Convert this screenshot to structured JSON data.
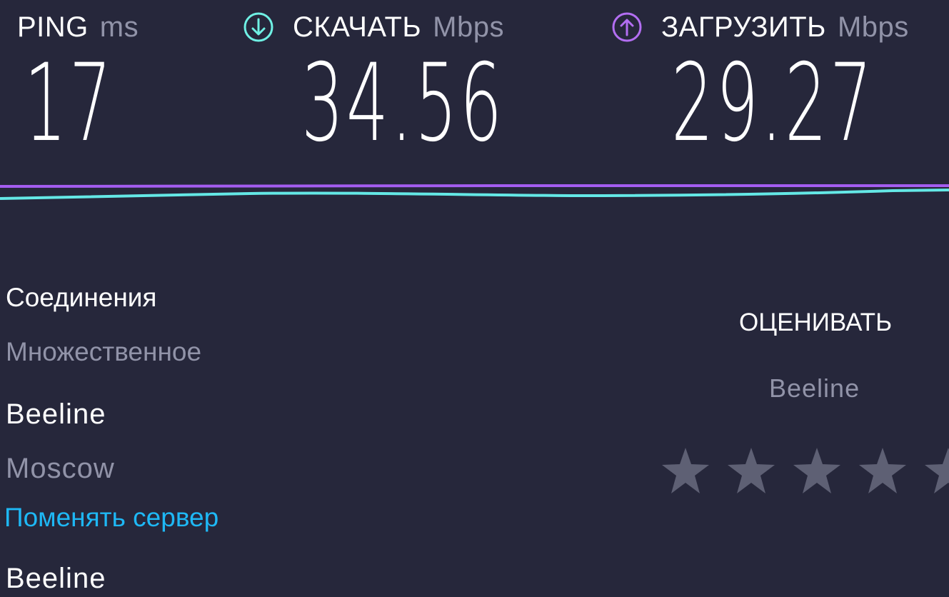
{
  "metrics": {
    "ping": {
      "name": "PING",
      "unit": "ms",
      "value": "17"
    },
    "download": {
      "name": "СКАЧАТЬ",
      "unit": "Mbps",
      "value": "34.56",
      "icon": "download-arrow-icon",
      "color": "#6ff0e4"
    },
    "upload": {
      "name": "ЗАГРУЗИТЬ",
      "unit": "Mbps",
      "value": "29.27",
      "icon": "upload-arrow-icon",
      "color": "#b36ef2"
    }
  },
  "graph": {
    "upload_color": "#a45df0",
    "download_color": "#64e8e6"
  },
  "connection": {
    "title": "Соединения",
    "type": "Множественное",
    "provider": "Beeline",
    "city": "Moscow",
    "change_server": "Поменять сервер",
    "server": "Beeline"
  },
  "rating": {
    "title": "ОЦЕНИВАТЬ",
    "provider": "Beeline",
    "stars_icon": "star-icon",
    "star_color": "#5e6074"
  },
  "colors": {
    "background": "#26273b",
    "muted_text": "#9193a8",
    "link": "#1eb8f5"
  }
}
